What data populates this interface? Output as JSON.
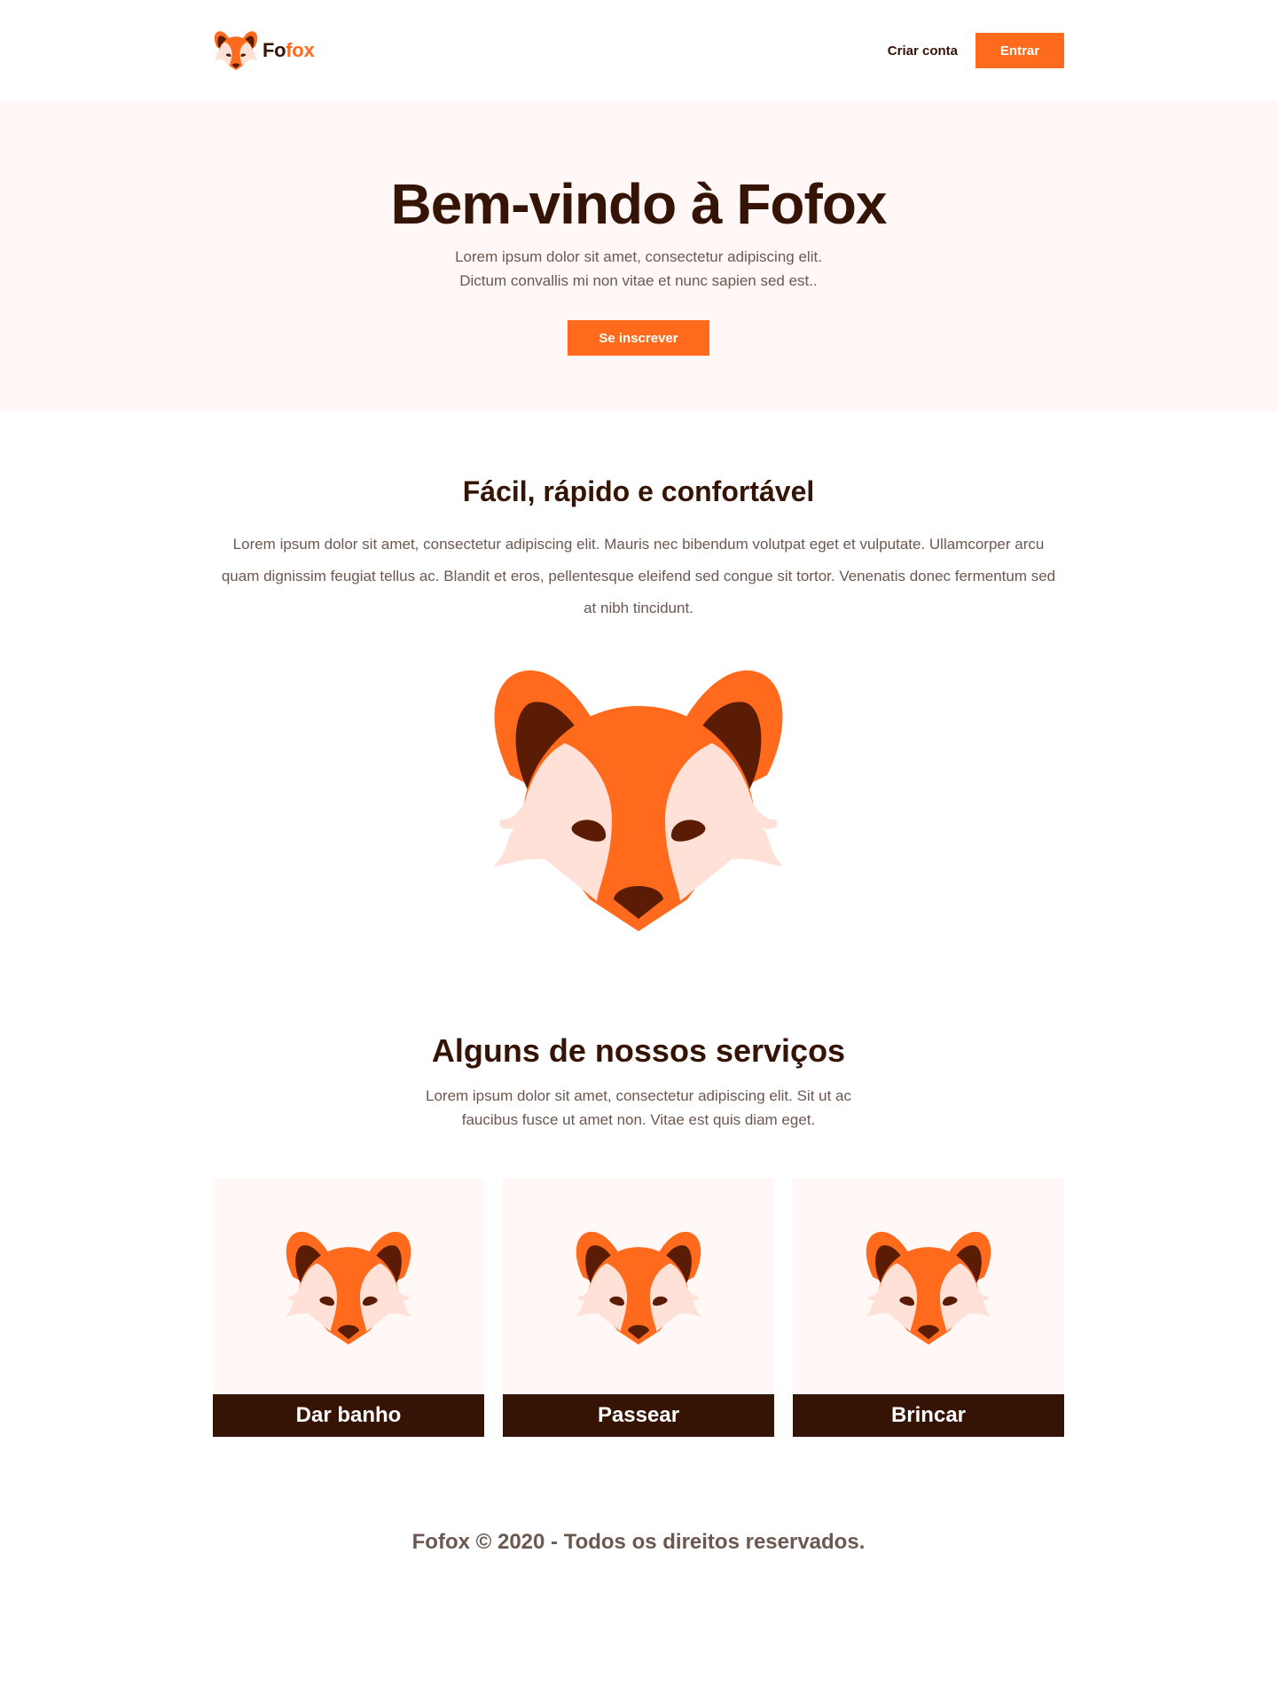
{
  "header": {
    "logo": {
      "part1": "Fo",
      "part2": "fox",
      "icon": "fox-head-icon"
    },
    "nav": {
      "signup_label": "Criar conta",
      "login_label": "Entrar"
    }
  },
  "hero": {
    "title": "Bem-vindo à Fofox",
    "line1": "Lorem ipsum dolor sit amet, consectetur adipiscing elit.",
    "line2": "Dictum convallis mi non vitae et nunc sapien sed est..",
    "cta_label": "Se inscrever"
  },
  "about": {
    "title": "Fácil, rápido e confortável",
    "text": "Lorem ipsum dolor sit amet, consectetur adipiscing elit. Mauris nec bibendum volutpat eget et vulputate. Ullamcorper arcu quam dignissim feugiat tellus ac. Blandit et eros, pellentesque eleifend sed congue sit tortor. Venenatis donec fermentum sed at nibh tincidunt.",
    "illustration": "fox-head-icon"
  },
  "services": {
    "title": "Alguns de nossos serviços",
    "text": "Lorem ipsum dolor sit amet, consectetur adipiscing elit. Sit ut ac faucibus fusce ut amet non. Vitae est quis diam eget.",
    "items": [
      {
        "label": "Dar banho",
        "icon": "fox-head-icon"
      },
      {
        "label": "Passear",
        "icon": "fox-head-icon"
      },
      {
        "label": "Brincar",
        "icon": "fox-head-icon"
      }
    ]
  },
  "footer": {
    "text": "Fofox © 2020 - Todos os direitos reservados."
  },
  "colors": {
    "accent": "#FF6A1C",
    "dark": "#351405",
    "text_muted": "#6b5850",
    "hero_bg": "#FFF8F6",
    "fox_light": "#FFE1D8"
  }
}
